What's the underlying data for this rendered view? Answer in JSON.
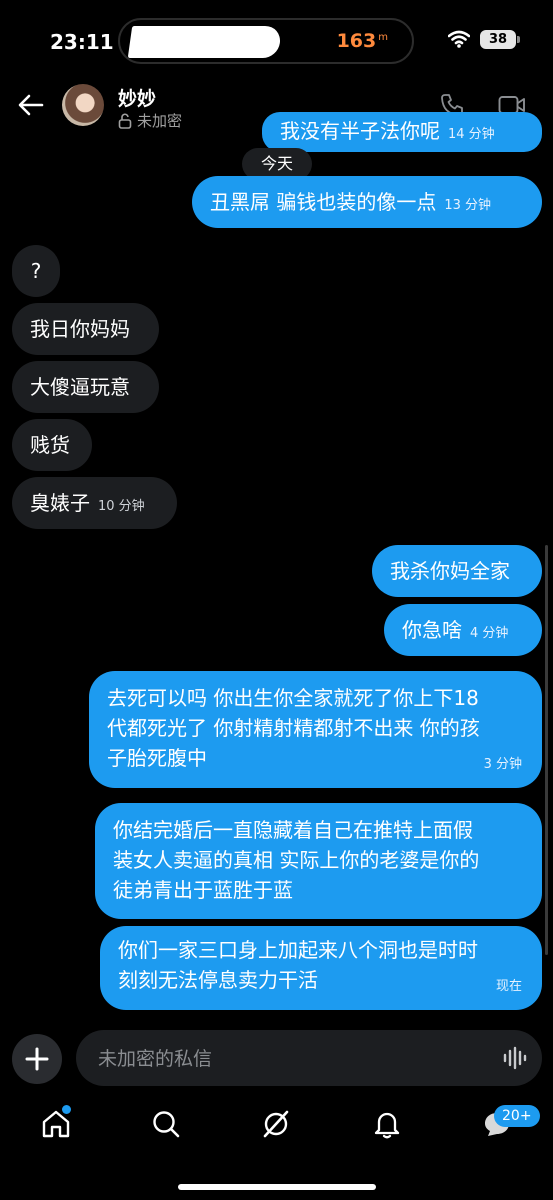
{
  "status": {
    "time": "23:11",
    "distance": "163",
    "distance_unit": "m",
    "battery": "38"
  },
  "header": {
    "name": "妙妙",
    "encryption": "未加密"
  },
  "date_separator": "今天",
  "messages": [
    {
      "text": "我没有半子法你呢",
      "time": "14 分钟",
      "dir": "out"
    },
    {
      "text": "丑黑屌 骗钱也装的像一点",
      "time": "13 分钟",
      "dir": "out"
    },
    {
      "text": "?",
      "dir": "in"
    },
    {
      "text": "我日你妈妈",
      "dir": "in"
    },
    {
      "text": "大傻逼玩意",
      "dir": "in"
    },
    {
      "text": "贱货",
      "dir": "in"
    },
    {
      "text": "臭婊子",
      "time": "10 分钟",
      "dir": "in"
    },
    {
      "text": "我杀你妈全家",
      "dir": "out"
    },
    {
      "text": "你急啥",
      "time": "4 分钟",
      "dir": "out"
    },
    {
      "lines": [
        "去死可以吗 你出生你全家就死了你上下18",
        "代都死光了 你射精射精都射不出来 你的孩",
        "子胎死腹中"
      ],
      "time": "3 分钟",
      "dir": "out"
    },
    {
      "lines": [
        "你结完婚后一直隐藏着自己在推特上面假",
        "装女人卖逼的真相 实际上你的老婆是你的",
        "徒弟青出于蓝胜于蓝"
      ],
      "dir": "out"
    },
    {
      "lines": [
        "你们一家三口身上加起来八个洞也是时时",
        "刻刻无法停息卖力干活"
      ],
      "time": "现在",
      "dir": "out"
    }
  ],
  "composer": {
    "placeholder": "未加密的私信"
  },
  "nav": {
    "messages_badge": "20+"
  },
  "colors": {
    "accent": "#1d9bf0",
    "incoming": "#1c1e21",
    "background": "#000000"
  }
}
